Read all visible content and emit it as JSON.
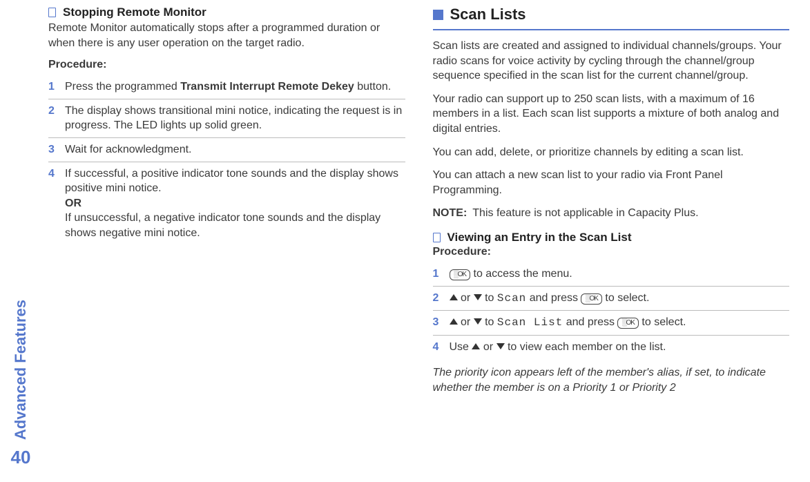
{
  "sidebar": {
    "label": "Advanced Features",
    "page": "40"
  },
  "left": {
    "section_title": "Stopping Remote Monitor",
    "intro": "Remote Monitor automatically stops after a programmed duration or when there is any user operation on the target radio.",
    "procedure_label": "Procedure:",
    "steps": {
      "s1_num": "1",
      "s1_a": "Press the programmed ",
      "s1_b": "Transmit Interrupt Remote Dekey",
      "s1_c": " button.",
      "s2_num": "2",
      "s2": "The display shows transitional mini notice, indicating the request is in progress. The LED lights up solid green.",
      "s3_num": "3",
      "s3": "Wait for acknowledgment.",
      "s4_num": "4",
      "s4_a": "If successful, a positive indicator tone sounds and the display shows positive mini notice.",
      "s4_or": "OR",
      "s4_b": "If unsuccessful, a negative indicator tone sounds and the display shows negative mini notice."
    }
  },
  "right": {
    "section_title": "Scan Lists",
    "p1": "Scan lists are created and assigned to individual channels/groups. Your radio scans for voice activity by cycling through the channel/group sequence specified in the scan list for the current channel/group.",
    "p2": "Your radio can support up to 250 scan lists, with a maximum of 16 members in a list. Each scan list supports a mixture of both analog and digital entries.",
    "p3": "You can add, delete, or prioritize channels by editing a scan list.",
    "p4": "You can attach a new scan list to your radio via Front Panel Programming.",
    "note_label": "NOTE:",
    "note_text": "This feature is not applicable in Capacity Plus.",
    "sub_title": "Viewing an Entry in the Scan List",
    "procedure_label": "Procedure:",
    "key_ok": "░OK",
    "steps": {
      "s1_num": "1",
      "s1_tail": " to access the menu.",
      "s2_num": "2",
      "s2_mid_a": " or ",
      "s2_mid_b": " to ",
      "s2_scan": "Scan",
      "s2_mid_c": " and press ",
      "s2_tail": " to select.",
      "s3_num": "3",
      "s3_mid_a": " or ",
      "s3_mid_b": " to ",
      "s3_scanlist": "Scan List",
      "s3_mid_c": " and press ",
      "s3_tail": " to select.",
      "s4_num": "4",
      "s4_a": "Use ",
      "s4_mid": " or ",
      "s4_b": " to view each member on the list."
    },
    "footer": "The priority icon appears left of the member's alias, if set, to indicate whether the member is on a Priority 1 or Priority 2"
  }
}
